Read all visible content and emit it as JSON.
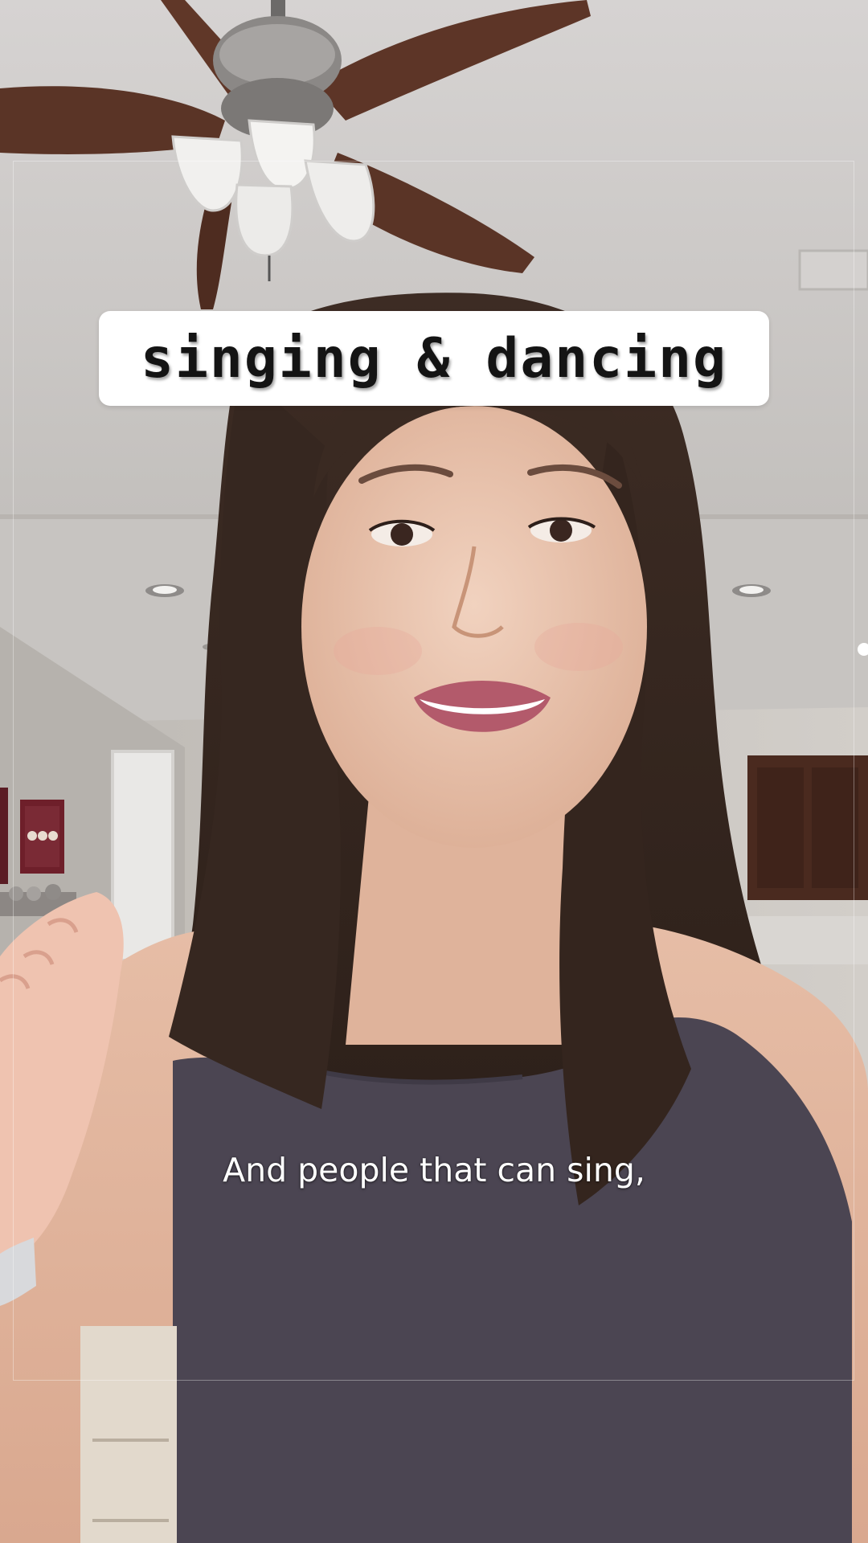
{
  "video": {
    "title_overlay": "singing & dancing",
    "caption": "And people that can sing,"
  },
  "scene": {
    "description_icons": [
      "ceiling-fan-icon",
      "ceiling-light-icon",
      "framed-art-icon"
    ],
    "colors": {
      "ceiling": "#cfccca",
      "wall": "#c4c0bb",
      "cabinet": "#4a2a1f",
      "hair": "#3a2a22",
      "skin": "#e9c3ad",
      "top": "#4b4552",
      "fan_blade": "#5a3426"
    }
  }
}
